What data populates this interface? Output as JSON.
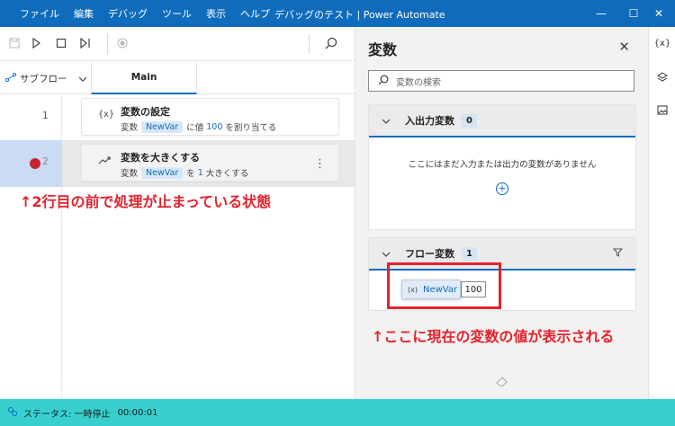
{
  "menu": [
    "ファイル",
    "編集",
    "デバッグ",
    "ツール",
    "表示",
    "ヘルプ"
  ],
  "window_title": "デバッグのテスト | Power Automate",
  "window_controls": {
    "minimize": "—",
    "maximize": "☐",
    "close": "✕"
  },
  "toolbar": {
    "icons": [
      "save-icon",
      "run-icon",
      "stop-icon",
      "step-icon",
      "record-icon",
      "search-icon"
    ]
  },
  "tabs": {
    "subflow_label": "サブフロー",
    "main_label": "Main"
  },
  "steps": [
    {
      "line": "1",
      "icon": "{x}",
      "title": "変数の設定",
      "prefix": "変数",
      "var": "NewVar",
      "mid": "に値",
      "value": "100",
      "suffix": "を割り当てる",
      "breakpoint": false
    },
    {
      "line": "2",
      "icon": "↗",
      "title": "変数を大きくする",
      "prefix": "変数",
      "var": "NewVar",
      "mid": "を",
      "value": "1",
      "suffix": "大きくする",
      "breakpoint": true
    }
  ],
  "annotations": {
    "stopped": "↑2行目の前で処理が止まっている状態",
    "value_shown": "↑ここに現在の変数の値が表示される"
  },
  "variables_panel": {
    "title": "変数",
    "search_placeholder": "変数の検索",
    "io_section": {
      "label": "入出力変数",
      "count": "0",
      "empty_text": "ここにはまだ入力または出力の変数がありません"
    },
    "flow_section": {
      "label": "フロー変数",
      "count": "1",
      "var_name": "NewVar",
      "var_value": "100"
    }
  },
  "status": {
    "label": "ステータス: 一時停止",
    "time": "00:00:01"
  },
  "colors": {
    "accent": "#0f6cbd",
    "status_bar": "#37d0ce",
    "annotation": "#e4222c",
    "breakpoint": "#c4262e"
  }
}
